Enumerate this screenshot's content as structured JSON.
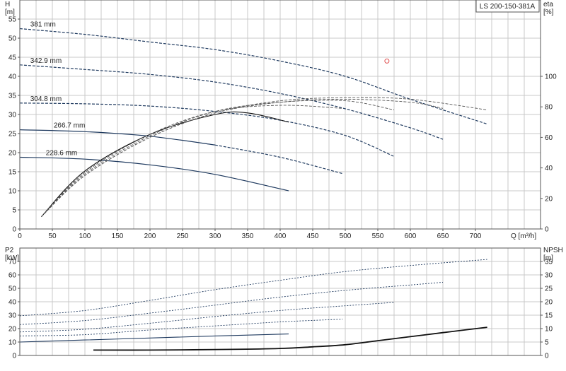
{
  "title": "LS 200-150-381A",
  "colors": {
    "grid": "#c8c8c8",
    "curve_dark": "#1f3a5f",
    "curve_black": "#111111",
    "curve_gray": "#555555",
    "operating_point": "#e05050"
  },
  "chart_data": [
    {
      "type": "line",
      "panel": "head-efficiency",
      "title": "",
      "xlabel": "Q [m³/h]",
      "ylabel": "H\n[m]",
      "y2label": "eta\n[%]",
      "xlim": [
        0,
        800
      ],
      "ylim": [
        0,
        60
      ],
      "y2lim": [
        0,
        150
      ],
      "xticks": [
        0,
        50,
        100,
        150,
        200,
        250,
        300,
        350,
        400,
        450,
        500,
        550,
        600,
        650,
        700
      ],
      "yticks": [
        0,
        5,
        10,
        15,
        20,
        25,
        30,
        35,
        40,
        45,
        50,
        55
      ],
      "y2ticks": [
        0,
        20,
        40,
        60,
        80,
        100
      ],
      "grid": true,
      "series": [
        {
          "name": "381 mm",
          "kind": "head",
          "style": "dashed",
          "x": [
            0,
            100,
            200,
            300,
            400,
            500,
            600,
            718
          ],
          "y": [
            52.5,
            51.0,
            49.0,
            47.0,
            44.0,
            40.0,
            34.0,
            27.5
          ]
        },
        {
          "name": "342.9 mm",
          "kind": "head",
          "style": "dashed",
          "x": [
            0,
            100,
            200,
            300,
            400,
            500,
            600,
            650
          ],
          "y": [
            43.0,
            41.8,
            40.5,
            38.5,
            35.5,
            31.5,
            26.5,
            23.5
          ]
        },
        {
          "name": "304.8 mm",
          "kind": "head",
          "style": "dashed",
          "x": [
            0,
            100,
            200,
            300,
            400,
            500,
            575
          ],
          "y": [
            33.0,
            32.8,
            32.2,
            30.8,
            28.5,
            24.5,
            19.0
          ]
        },
        {
          "name": "266.7 mm",
          "kind": "head",
          "style": "mixed",
          "x": [
            0,
            100,
            200,
            300,
            400,
            496
          ],
          "y": [
            26.0,
            25.5,
            24.3,
            22.0,
            18.8,
            14.5
          ]
        },
        {
          "name": "228.6 mm",
          "kind": "head",
          "style": "solid",
          "x": [
            0,
            100,
            200,
            300,
            413
          ],
          "y": [
            18.8,
            18.3,
            16.8,
            14.3,
            10.0
          ]
        },
        {
          "kind": "eta",
          "style": "solid",
          "x": [
            33,
            100,
            200,
            300,
            350,
            413
          ],
          "y": [
            8,
            38,
            62,
            75,
            76,
            70
          ]
        },
        {
          "kind": "eta",
          "style": "dashed",
          "x": [
            33,
            100,
            200,
            300,
            400,
            496
          ],
          "y": [
            8,
            37,
            62,
            77,
            81,
            79
          ]
        },
        {
          "kind": "eta",
          "style": "dashed",
          "x": [
            33,
            100,
            200,
            300,
            400,
            500,
            575
          ],
          "y": [
            8,
            36,
            61,
            77,
            83,
            84,
            78
          ]
        },
        {
          "kind": "eta",
          "style": "dashed",
          "x": [
            33,
            100,
            200,
            300,
            400,
            500,
            600,
            650
          ],
          "y": [
            8,
            35,
            60,
            76,
            83,
            85,
            83,
            79
          ]
        },
        {
          "kind": "eta",
          "style": "dashed",
          "x": [
            33,
            100,
            200,
            300,
            400,
            500,
            600,
            718
          ],
          "y": [
            8,
            35,
            60,
            76,
            84,
            86,
            85,
            78
          ]
        }
      ],
      "points": [
        {
          "x": 564,
          "y": 44.0
        }
      ]
    },
    {
      "type": "line",
      "panel": "power-npsh",
      "title": "",
      "xlabel": "",
      "ylabel": "P2\n[kW]",
      "y2label": "NPSH\n[m]",
      "xlim": [
        0,
        800
      ],
      "ylim": [
        0,
        80
      ],
      "y2lim": [
        0,
        40
      ],
      "yticks": [
        0,
        10,
        20,
        30,
        40,
        50,
        60,
        70
      ],
      "y2ticks": [
        0,
        5,
        10,
        15,
        20,
        25,
        30,
        35
      ],
      "grid": true,
      "series": [
        {
          "kind": "power",
          "style": "dotted",
          "x": [
            0,
            100,
            200,
            300,
            400,
            500,
            600,
            718
          ],
          "y": [
            29.5,
            33.5,
            41.0,
            49.0,
            56.0,
            62.5,
            67.0,
            71.5
          ]
        },
        {
          "kind": "power",
          "style": "dotted",
          "x": [
            0,
            100,
            200,
            300,
            400,
            500,
            600,
            650
          ],
          "y": [
            23.0,
            26.0,
            31.5,
            37.5,
            43.5,
            48.5,
            52.5,
            54.5
          ]
        },
        {
          "kind": "power",
          "style": "dotted",
          "x": [
            0,
            100,
            200,
            300,
            400,
            500,
            575
          ],
          "y": [
            17.5,
            19.5,
            24.0,
            29.0,
            33.5,
            37.0,
            39.5
          ]
        },
        {
          "kind": "power",
          "style": "dotted",
          "x": [
            0,
            100,
            200,
            300,
            400,
            496
          ],
          "y": [
            14.5,
            15.5,
            19.0,
            22.0,
            25.0,
            27.0
          ]
        },
        {
          "kind": "power",
          "style": "solid",
          "x": [
            0,
            100,
            200,
            300,
            413
          ],
          "y": [
            10.0,
            11.5,
            13.0,
            14.5,
            16.0
          ]
        },
        {
          "kind": "npsh",
          "style": "solid",
          "x": [
            113,
            200,
            300,
            400,
            450,
            500,
            550,
            600,
            650,
            718
          ],
          "y": [
            2.0,
            2.0,
            2.2,
            2.6,
            3.2,
            4.0,
            5.5,
            7.0,
            8.5,
            10.5
          ]
        }
      ]
    }
  ]
}
